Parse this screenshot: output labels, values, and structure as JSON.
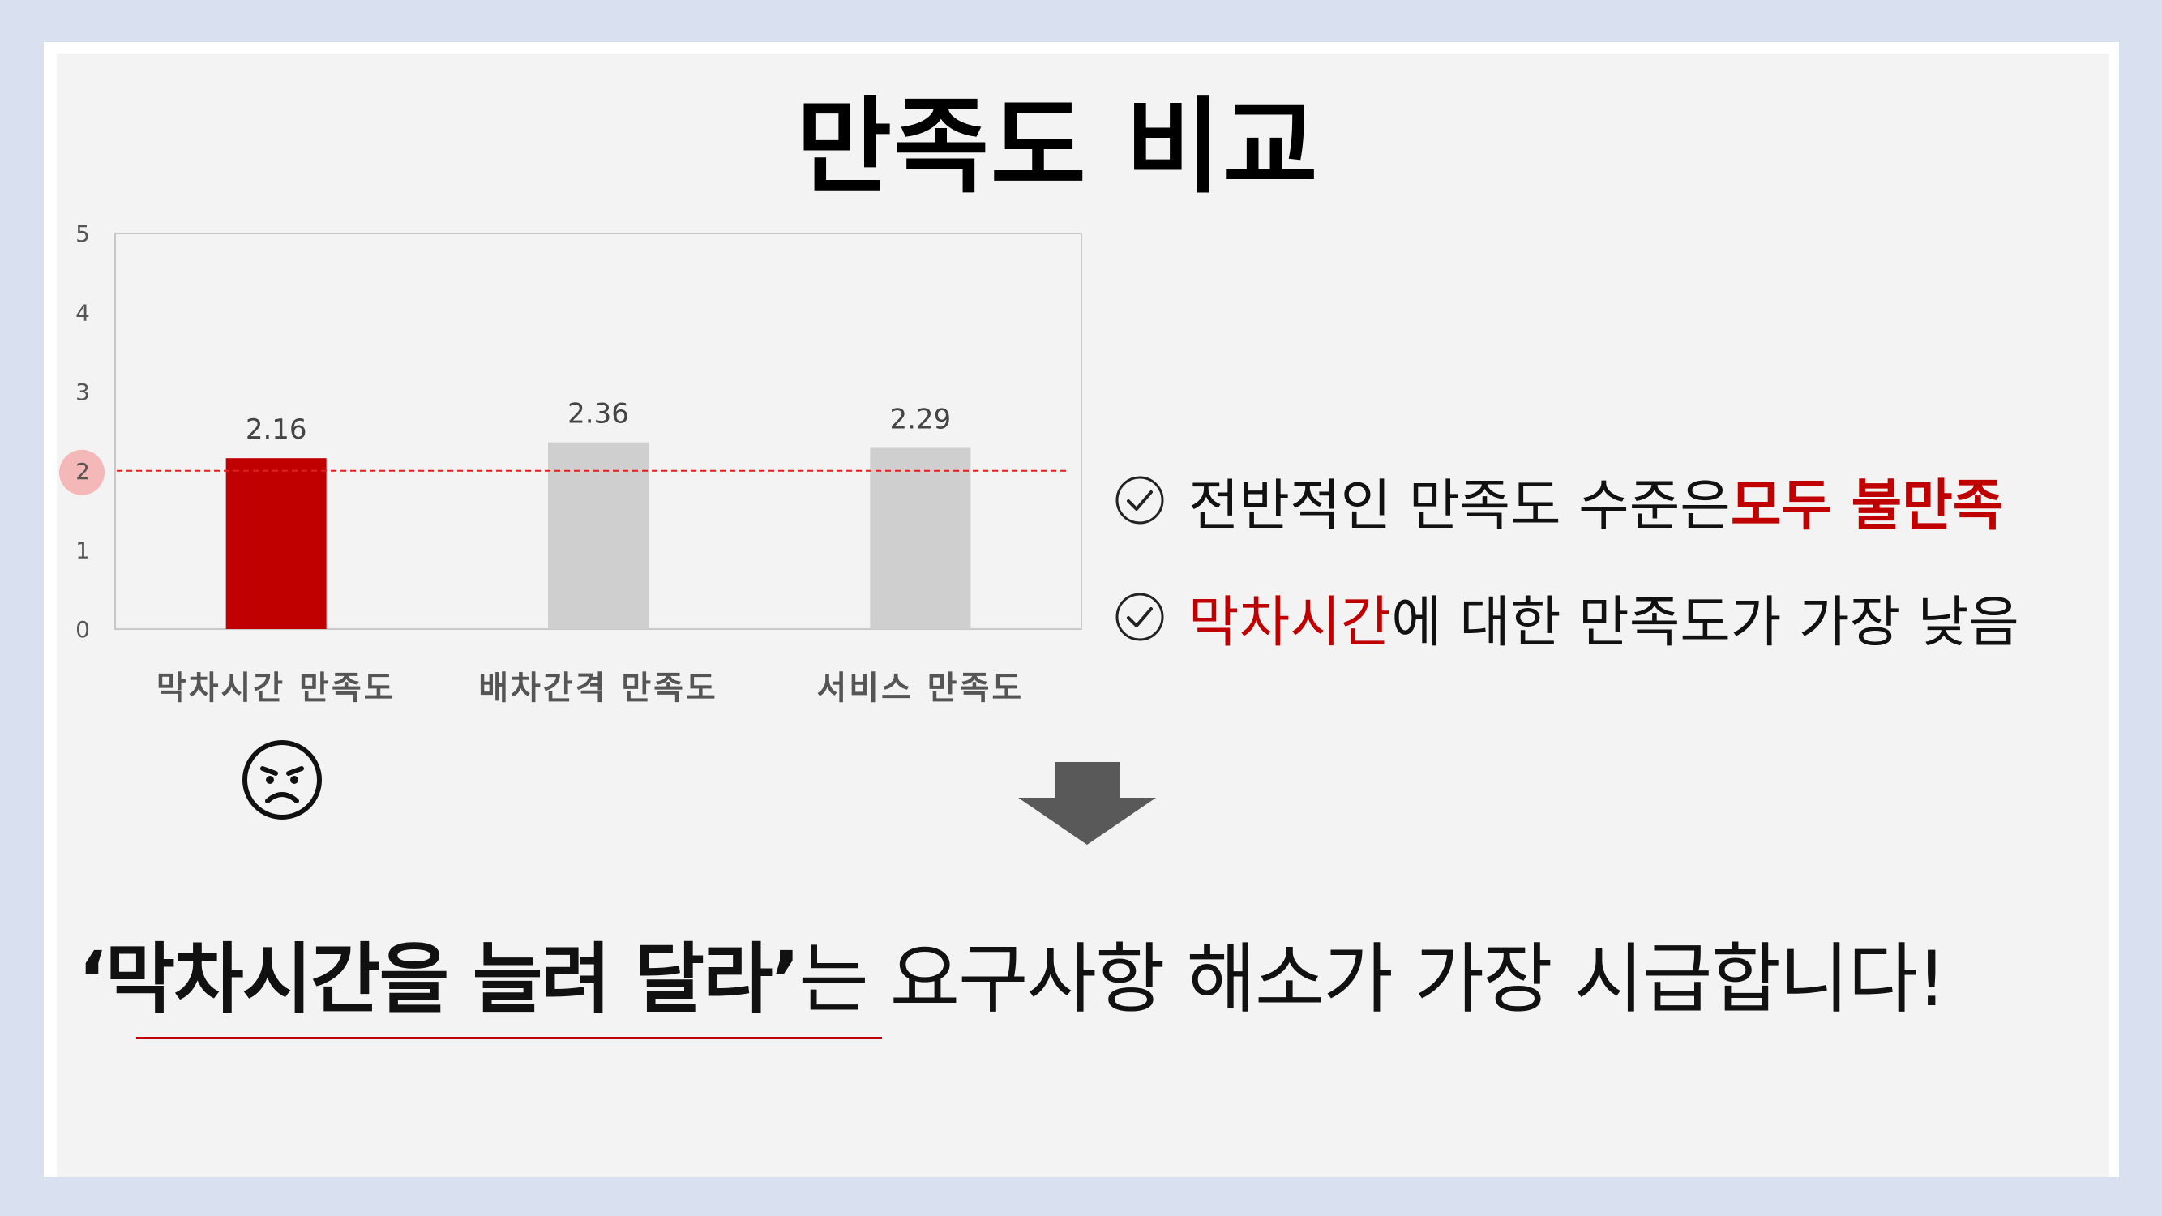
{
  "title": "만족도 비교",
  "chart_data": {
    "type": "bar",
    "categories": [
      "막차시간 만족도",
      "배차간격 만족도",
      "서비스 만족도"
    ],
    "values": [
      2.16,
      2.36,
      2.29
    ],
    "data_labels": [
      "2.16",
      "2.36",
      "2.29"
    ],
    "yticks": [
      "0",
      "1",
      "2",
      "3",
      "4",
      "5"
    ],
    "ylim": [
      0,
      5
    ],
    "reference_line": 2,
    "highlight_index": 0,
    "colors": {
      "highlight": "#c00000",
      "default": "#d0cfcf",
      "reference": "#e02020",
      "reference_marker": "#f4b8b8"
    }
  },
  "face_icon": "angry-face-icon",
  "bullets": [
    {
      "icon": "check-circle-icon",
      "text_plain": "전반적인 만족도 수준은 ",
      "text_red": "모두 불만족"
    },
    {
      "icon": "check-circle-icon",
      "text_red": "막차시간",
      "text_plain": "에 대한 만족도가 가장 낮음"
    }
  ],
  "arrow_icon": "down-arrow-icon",
  "conclusion": {
    "highlight": "‘막차시간을 늘려 달라’",
    "rest": "는 요구사항 해소가 가장 시급합니다!"
  }
}
